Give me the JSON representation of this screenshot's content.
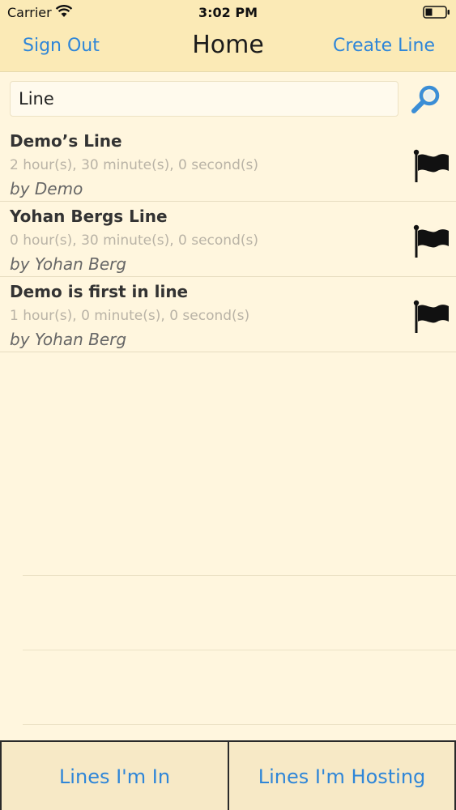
{
  "status_bar": {
    "carrier": "Carrier",
    "time": "3:02 PM",
    "wifi_icon": "wifi-icon",
    "battery_icon": "battery-icon"
  },
  "nav": {
    "left_label": "Sign Out",
    "title": "Home",
    "right_label": "Create Line"
  },
  "search": {
    "value": "Line",
    "icon": "search-icon"
  },
  "lines": [
    {
      "title": "Demo’s Line",
      "duration": "2 hour(s), 30 minute(s), 0 second(s)",
      "author": "by Demo",
      "icon": "flag-icon"
    },
    {
      "title": "Yohan Bergs Line",
      "duration": "0 hour(s), 30 minute(s), 0 second(s)",
      "author": "by Yohan Berg",
      "icon": "flag-icon"
    },
    {
      "title": "Demo is first in line",
      "duration": "1 hour(s), 0 minute(s), 0 second(s)",
      "author": "by Yohan Berg",
      "icon": "flag-icon"
    }
  ],
  "tabs": {
    "left_label": "Lines I'm In",
    "right_label": "Lines I'm Hosting"
  },
  "colors": {
    "accent": "#2f86d8",
    "nav_background": "#fbeab6",
    "page_background": "#fff6de"
  }
}
